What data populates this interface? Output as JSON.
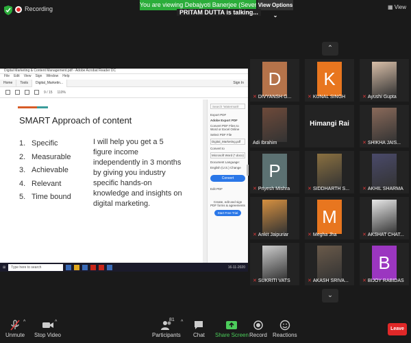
{
  "top": {
    "recording_label": "Recording",
    "banner": "You are viewing Debajyoti Banerjee (Seven Boat...'s screen",
    "view_options": "View Options",
    "talking": "PRITAM DUTTA is talking...",
    "view_label": "View"
  },
  "acrobat": {
    "title": "Digital Marketing & Content Management.pdf - Adobe Acrobat Reader DC",
    "menus": [
      "File",
      "Edit",
      "View",
      "Sign",
      "Window",
      "Help"
    ],
    "tabs": [
      "Home",
      "Tools",
      "Digital_Marketin..."
    ],
    "sign_in": "Sign In",
    "zoom": "110%",
    "page": "9 / 15",
    "right_panel": {
      "search": "Search 'Watermark'",
      "export_pdf": "Export PDF",
      "adobe_export": "Adobe Export PDF",
      "convert_desc": "Convert PDF Files to Word or Excel Online",
      "select_file": "Select PDF File",
      "file_name": "Digital_Marketing.pdf",
      "convert_to": "Convert to",
      "format": "Microsoft Word (*.docx)",
      "doc_lang": "Document Language:",
      "lang_value": "English (U.S.) Change",
      "convert_btn": "Convert",
      "edit_pdf": "Edit PDF",
      "promo": "Create, edit and sign PDF forms & agreements",
      "trial_btn": "Start Free Trial"
    }
  },
  "slide": {
    "title": "SMART Approach of content",
    "items": [
      "Specific",
      "Measurable",
      "Achievable",
      "Relevant",
      "Time bound"
    ],
    "body": "I will help you get a 5 figure income independently in 3 months by giving you industry specific hands-on knowledge and insights on digital marketing."
  },
  "taskbar": {
    "search_placeholder": "Type here to search",
    "clock": "16-11-2020"
  },
  "participants": [
    {
      "name": "DIVYANSH G...",
      "letter": "D",
      "color": "#b5734a",
      "muted": true
    },
    {
      "name": "KUNAL SINGH",
      "letter": "K",
      "color": "#e8761f",
      "muted": true
    },
    {
      "name": "Ayushi Gupta",
      "letter": "",
      "color": "#d9bfa8",
      "muted": true
    },
    {
      "name": "Adi Ibrahim",
      "letter": "",
      "color": "#6e4a3a",
      "muted": false
    },
    {
      "name": "Himangi Rai",
      "letter": "",
      "color": "",
      "muted": false
    },
    {
      "name": "SHIKHA JAIS...",
      "letter": "",
      "color": "#8a6a5a",
      "muted": true
    },
    {
      "name": "Priyesh Mishra",
      "letter": "P",
      "color": "#5c7172",
      "muted": true
    },
    {
      "name": "SIDDHARTH S...",
      "letter": "",
      "color": "#8a7040",
      "muted": true
    },
    {
      "name": "AKHIL SHARMA",
      "letter": "",
      "color": "#4a4a6a",
      "muted": true
    },
    {
      "name": "Ankit Jaipuriar",
      "letter": "",
      "color": "#d69040",
      "muted": true
    },
    {
      "name": "Megha Jha",
      "letter": "M",
      "color": "#e8761f",
      "muted": true
    },
    {
      "name": "AKSHAT CHAT...",
      "letter": "",
      "color": "#e8e8e8",
      "muted": true
    },
    {
      "name": "SUKRITI VATS",
      "letter": "",
      "color": "#cccccc",
      "muted": true
    },
    {
      "name": "AKASH SRIVA...",
      "letter": "",
      "color": "#6a5a4a",
      "muted": true
    },
    {
      "name": "BIJOY RABIDAS",
      "letter": "B",
      "color": "#9b36c0",
      "muted": true
    }
  ],
  "controls": {
    "unmute": "Unmute",
    "stop_video": "Stop Video",
    "participants": "Participants",
    "participants_count": "81",
    "chat": "Chat",
    "share_screen": "Share Screen",
    "record": "Record",
    "reactions": "Reactions",
    "leave": "Leave"
  },
  "colors": {
    "banner_green": "#2bad3a",
    "share_green": "#4ccd5b",
    "leave_red": "#e02828",
    "muted_red": "#e03a3a"
  }
}
